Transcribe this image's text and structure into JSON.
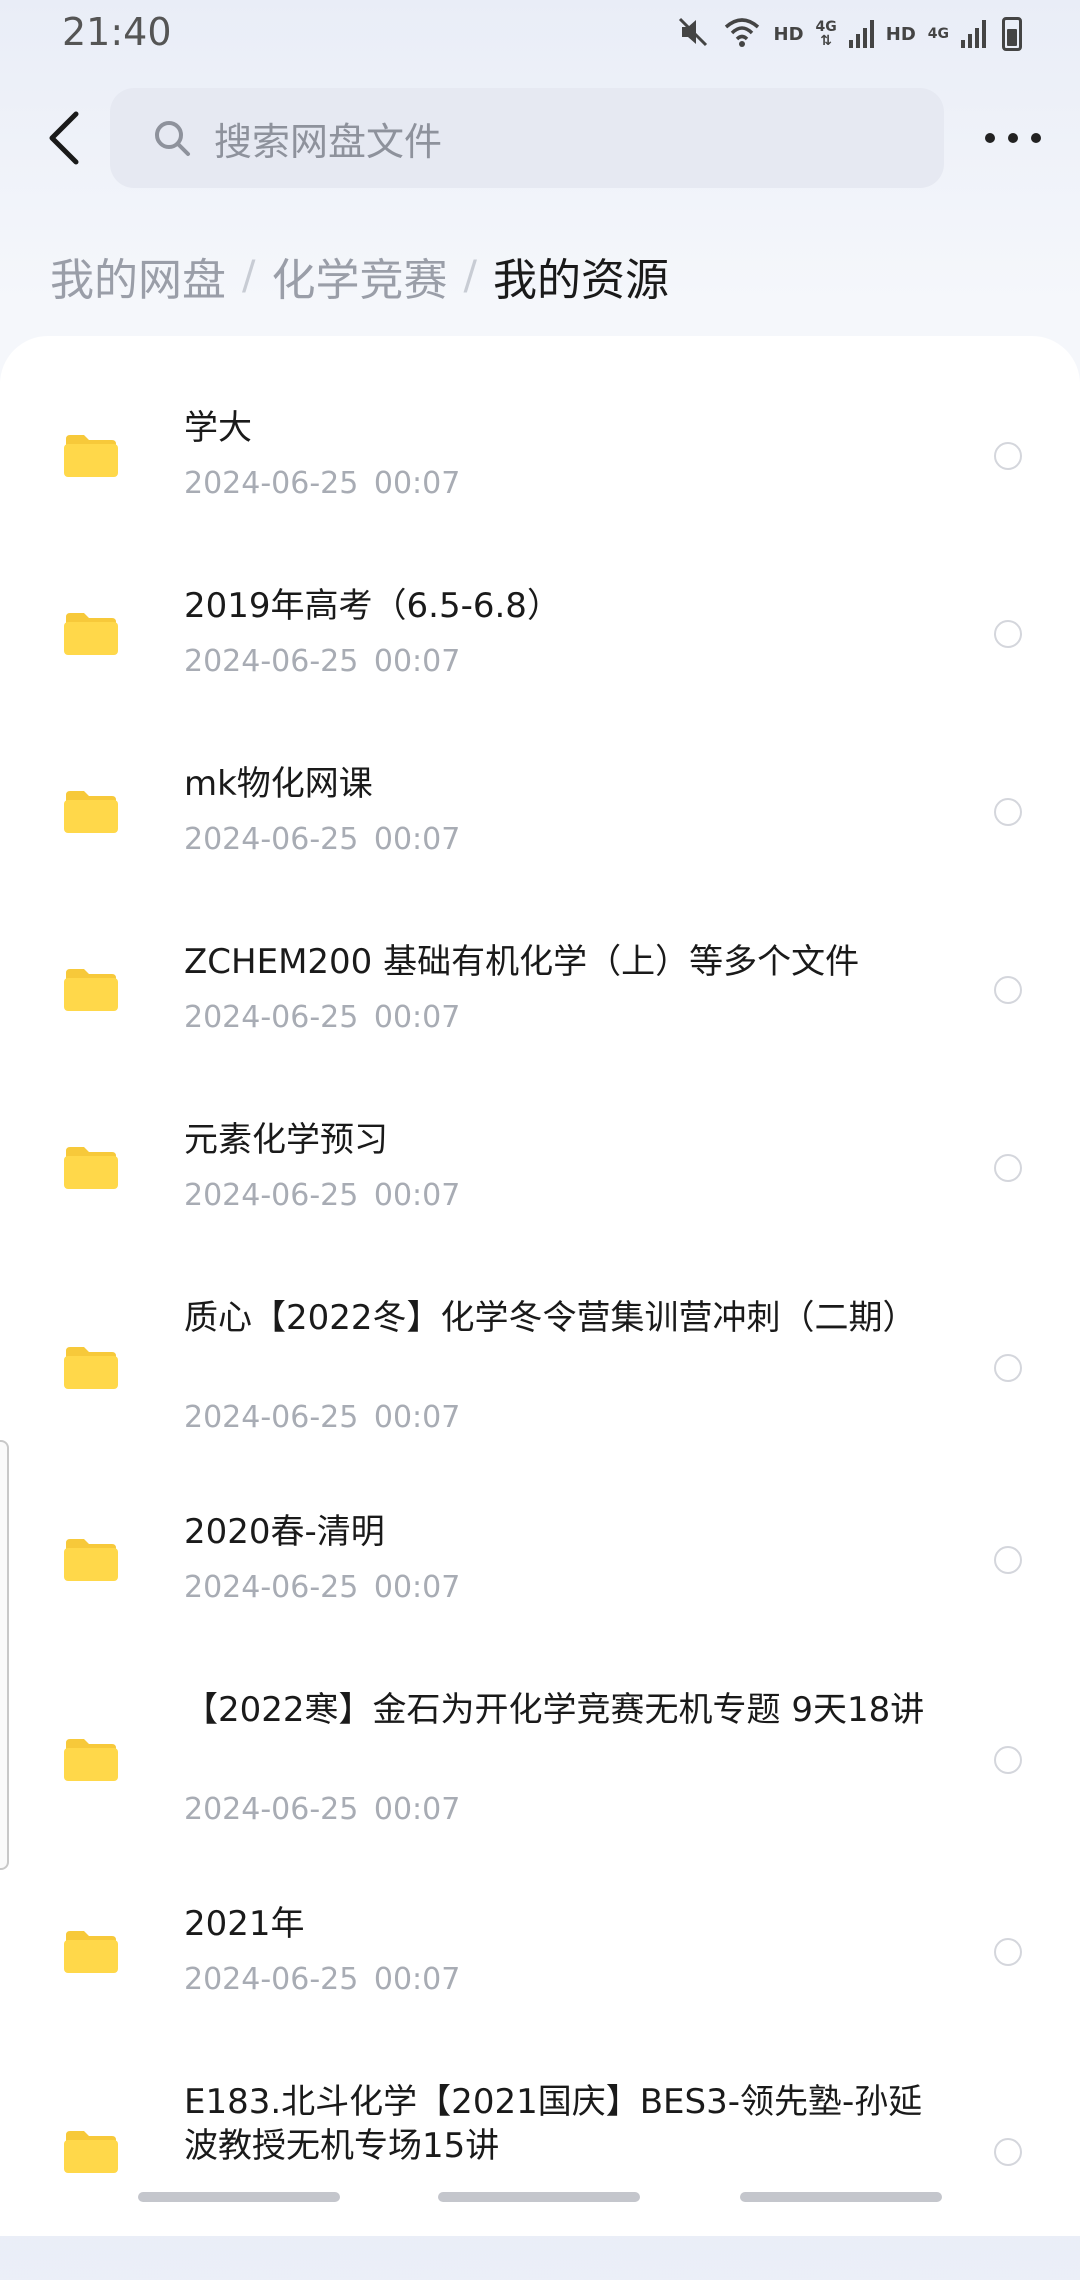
{
  "status_bar": {
    "time": "21:40",
    "icons": [
      "mute-icon",
      "wifi-icon",
      "signal-icon",
      "battery-icon"
    ],
    "hd1": "HD",
    "net1": "4G",
    "hd2": "HD",
    "net2": "4G"
  },
  "search": {
    "placeholder": "搜索网盘文件"
  },
  "breadcrumb": {
    "items": [
      "我的网盘",
      "化学竞赛",
      "我的资源"
    ],
    "separator": "/"
  },
  "files": [
    {
      "name": "学大",
      "date": "2024-06-25  00:07"
    },
    {
      "name": "2019年高考（6.5-6.8）",
      "date": "2024-06-25  00:07"
    },
    {
      "name": "mk物化网课",
      "date": "2024-06-25  00:07"
    },
    {
      "name": "ZCHEM200 基础有机化学（上）等多个文件",
      "date": "2024-06-25  00:07"
    },
    {
      "name": "元素化学预习",
      "date": "2024-06-25  00:07"
    },
    {
      "name": "质心【2022冬】化学冬令营集训营冲刺（二期）",
      "date": "2024-06-25  00:07"
    },
    {
      "name": "2020春-清明",
      "date": "2024-06-25  00:07"
    },
    {
      "name": "【2022寒】金石为开化学竞赛无机专题 9天18讲",
      "date": "2024-06-25  00:07"
    },
    {
      "name": "2021年",
      "date": "2024-06-25  00:07"
    },
    {
      "name": "E183.北斗化学【2021国庆】BES3-领先塾-孙延波教授无机专场15讲",
      "date": ""
    }
  ],
  "colors": {
    "folder": "#ffd84a",
    "folder_tab": "#f7c93a",
    "accent_text": "#1a1a1a",
    "muted_text": "#a8acb4"
  }
}
